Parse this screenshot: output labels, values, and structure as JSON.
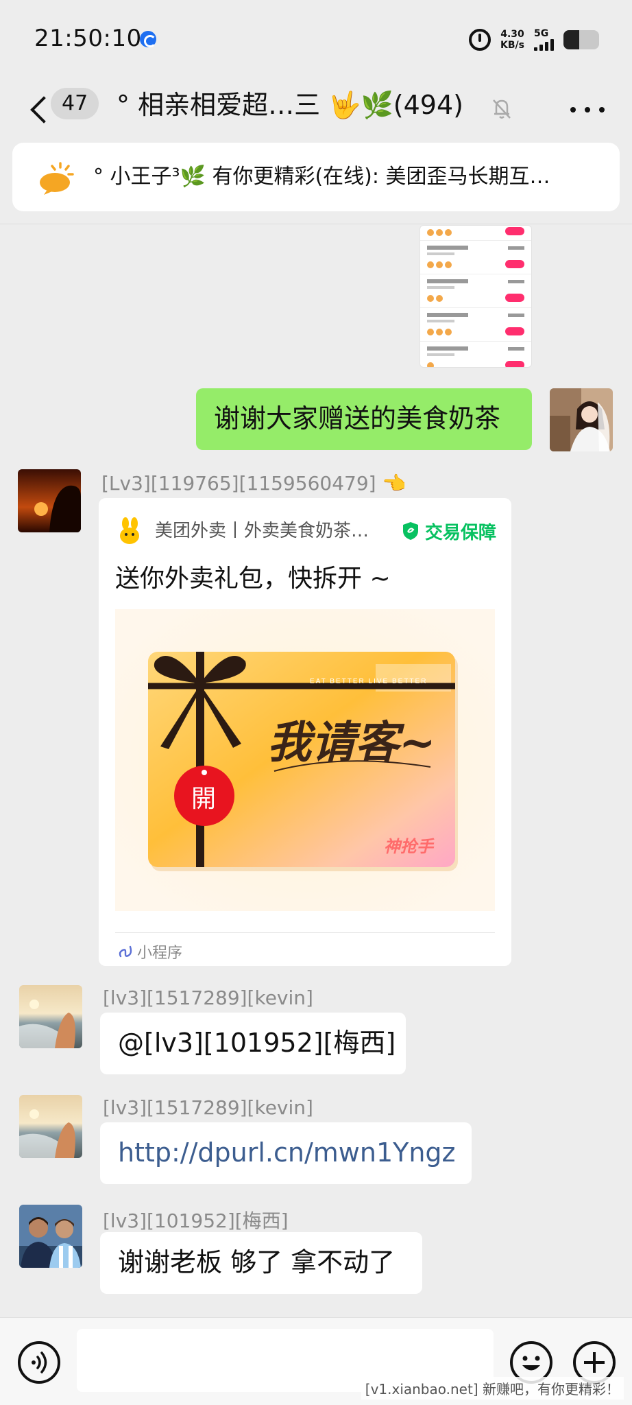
{
  "status_bar": {
    "time": "21:50:10",
    "net_speed_value": "4.30",
    "net_speed_unit": "KB/s",
    "network_type": "5G",
    "battery_level": 0.45
  },
  "nav": {
    "unread_count": "47",
    "title": "° 相亲相爱超…三 🤟🌿(494)"
  },
  "pinned": {
    "text": "° 小王子³🌿 有你更精彩(在线): 美团歪马长期互…"
  },
  "messages": {
    "m1": {
      "text": "谢谢大家赠送的美食奶茶"
    },
    "m2": {
      "sender": "[Lv3][119765][1159560479] 👈",
      "mini_program": {
        "app_name": "美团外卖丨外卖美食奶茶…",
        "badge": "交易保障",
        "description": "送你外卖礼包，快拆开 ~",
        "image_slogan": "EAT BETTER LIVE BETTER",
        "image_headline": "我请客~",
        "image_open": "開",
        "image_brand": "神抢手",
        "footer": "小程序"
      }
    },
    "m3": {
      "sender": "[lv3][1517289][kevin]",
      "text": "@[lv3][101952][梅西]"
    },
    "m4": {
      "sender": "[lv3][1517289][kevin]",
      "text": "http://dpurl.cn/mwn1Yngz"
    },
    "m5": {
      "sender": "[lv3][101952][梅西]",
      "text": "谢谢老板 够了 拿不动了"
    }
  },
  "colors": {
    "bubble_green": "#95ec69",
    "link": "#3c5d8f",
    "trade_green": "#07c160"
  },
  "watermark": "[v1.xianbao.net] 新赚吧，有你更精彩！"
}
